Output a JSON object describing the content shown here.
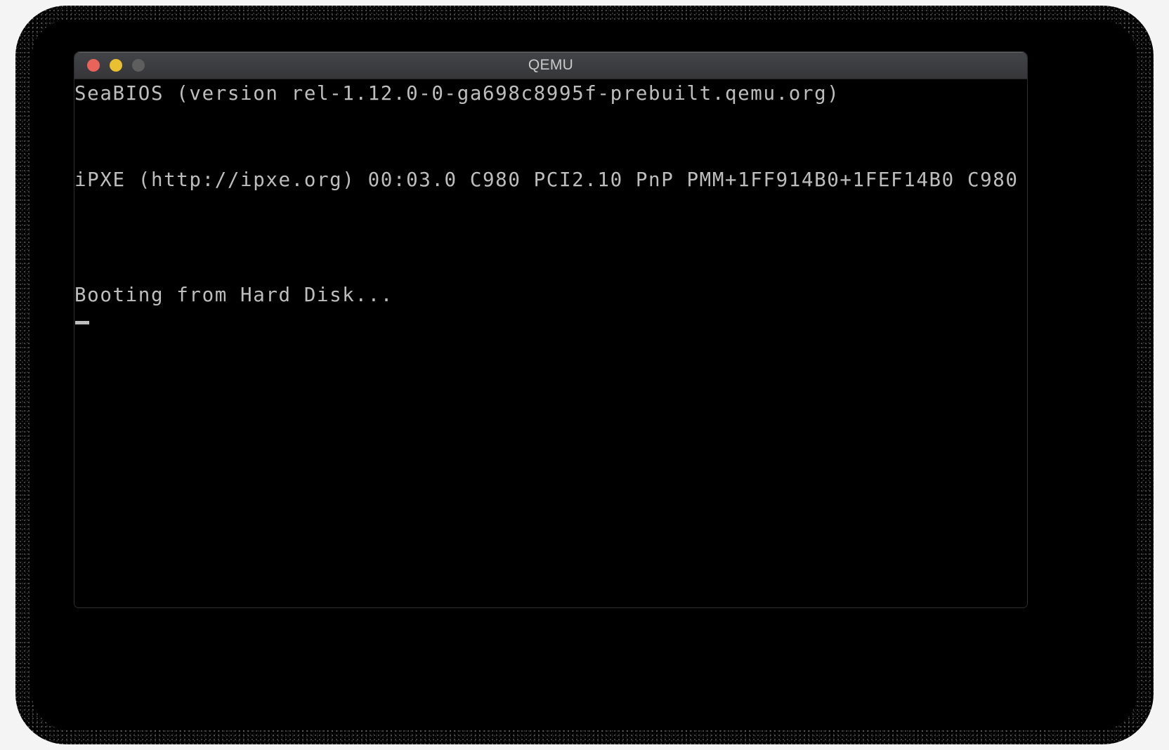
{
  "window": {
    "title": "QEMU",
    "controls": [
      {
        "name": "close",
        "color": "#e8645a"
      },
      {
        "name": "minimize",
        "color": "#e8c030"
      },
      {
        "name": "maximize",
        "color": "#5e5e5e"
      }
    ]
  },
  "terminal": {
    "foreground": "#bdbdbd",
    "background": "#000000",
    "lines": [
      "SeaBIOS (version rel-1.12.0-0-ga698c8995f-prebuilt.qemu.org)",
      "",
      "",
      "iPXE (http://ipxe.org) 00:03.0 C980 PCI2.10 PnP PMM+1FF914B0+1FEF14B0 C980",
      "",
      "",
      "",
      "Booting from Hard Disk..."
    ],
    "cursor": "_"
  }
}
